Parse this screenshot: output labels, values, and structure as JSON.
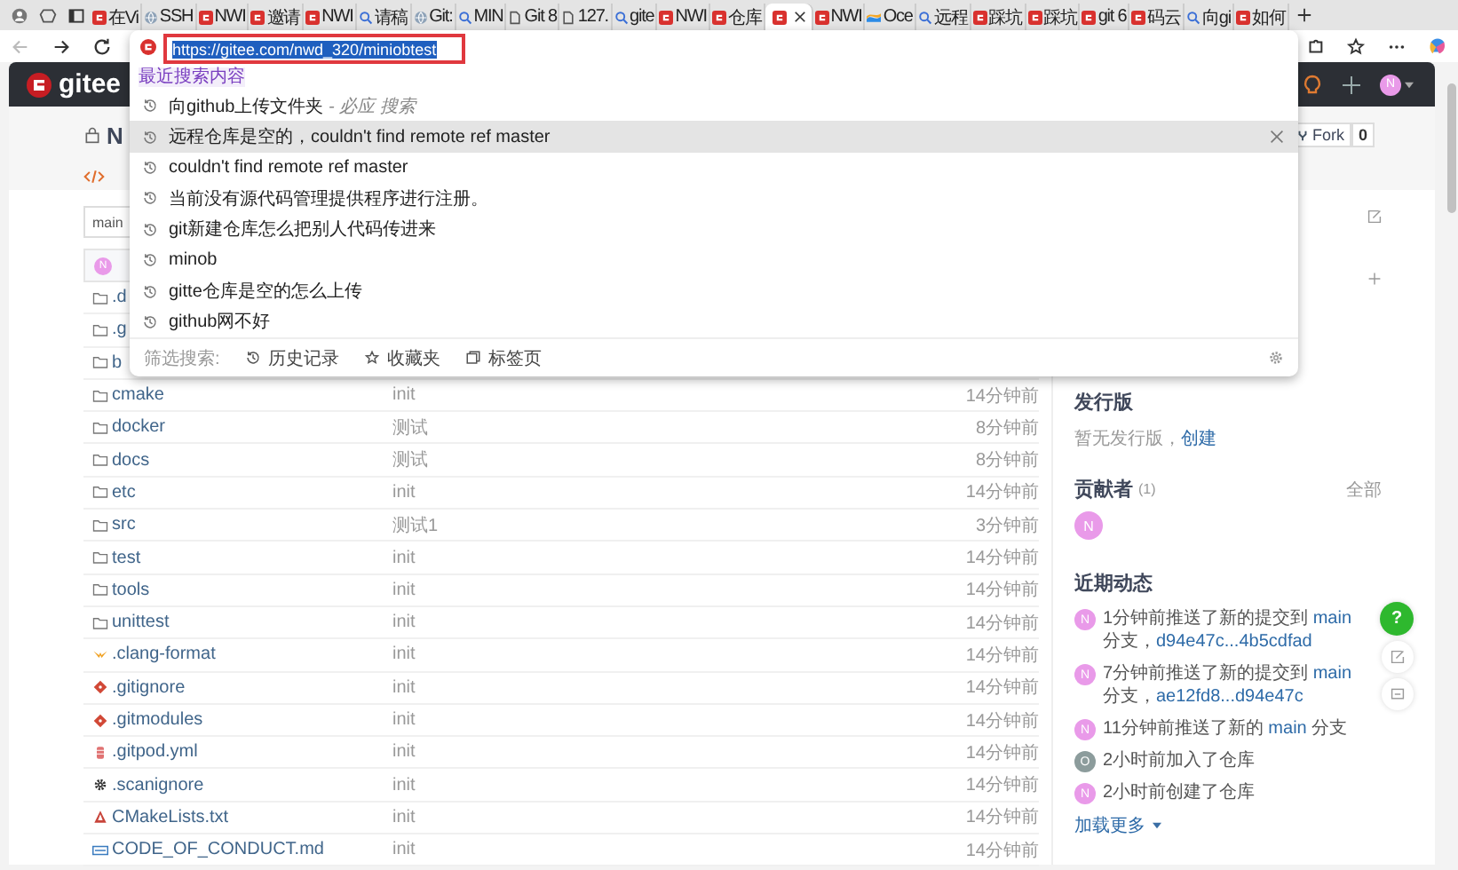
{
  "browser": {
    "tabs": [
      {
        "label": "在Vi",
        "kind": "gitee",
        "selected": false
      },
      {
        "label": "SSH",
        "kind": "globe",
        "selected": false
      },
      {
        "label": "NWI",
        "kind": "gitee",
        "selected": false
      },
      {
        "label": "邀请",
        "kind": "gitee",
        "selected": false
      },
      {
        "label": "NWI",
        "kind": "gitee",
        "selected": false
      },
      {
        "label": "请稿",
        "kind": "search",
        "selected": false
      },
      {
        "label": "Git:",
        "kind": "globe",
        "selected": false
      },
      {
        "label": "MIN",
        "kind": "search",
        "selected": false
      },
      {
        "label": "Git 8",
        "kind": "doc",
        "selected": false
      },
      {
        "label": "127.",
        "kind": "doc",
        "selected": false
      },
      {
        "label": "gite",
        "kind": "search",
        "selected": false
      },
      {
        "label": "NWI",
        "kind": "gitee",
        "selected": false
      },
      {
        "label": "仓库",
        "kind": "gitee",
        "selected": false
      },
      {
        "kind": "gitee",
        "selected": true
      },
      {
        "label": "NWI",
        "kind": "gitee",
        "selected": false
      },
      {
        "label": "Oce",
        "kind": "color",
        "selected": false
      },
      {
        "label": "远程",
        "kind": "search",
        "selected": false
      },
      {
        "label": "踩坑",
        "kind": "gitee",
        "selected": false
      },
      {
        "label": "踩坑",
        "kind": "gitee",
        "selected": false
      },
      {
        "label": "git 6",
        "kind": "gitee",
        "selected": false
      },
      {
        "label": "码云",
        "kind": "gitee",
        "selected": false
      },
      {
        "label": "向gi",
        "kind": "search",
        "selected": false
      },
      {
        "label": "如何",
        "kind": "gitee",
        "selected": false
      }
    ],
    "address": "https://gitee.com/nwd_320/miniobtest",
    "suggestions": {
      "heading": "最近搜索内容",
      "items": [
        {
          "text": "向github上传文件夹",
          "hint": "- 必应 搜索",
          "selected": false
        },
        {
          "text": "远程仓库是空的，couldn't find remote ref master",
          "selected": true
        },
        {
          "text": "couldn't find remote ref master",
          "selected": false
        },
        {
          "text": "当前没有源代码管理提供程序进行注册。",
          "selected": false
        },
        {
          "text": "git新建仓库怎么把别人代码传进来",
          "selected": false
        },
        {
          "text": "minob",
          "selected": false
        },
        {
          "text": "gitte仓库是空的怎么上传",
          "selected": false
        },
        {
          "text": "github网不好",
          "selected": false
        }
      ],
      "filter_label": "筛选搜索:",
      "filters": [
        {
          "label": "历史记录",
          "kind": "history"
        },
        {
          "label": "收藏夹",
          "kind": "star"
        },
        {
          "label": "标签页",
          "kind": "tabs"
        }
      ]
    }
  },
  "gitee": {
    "logo": "gitee",
    "avatar": "N"
  },
  "repo": {
    "title": "N",
    "fork_label": "Fork",
    "fork_count": "0",
    "branch": "main",
    "commit_avatar": "N"
  },
  "files": [
    {
      "name": ".d",
      "kind": "folder"
    },
    {
      "name": ".g",
      "kind": "folder"
    },
    {
      "name": "b",
      "kind": "folder"
    },
    {
      "name": "cmake",
      "kind": "folder",
      "message": "init",
      "time": "14分钟前"
    },
    {
      "name": "docker",
      "kind": "folder",
      "message": "测试",
      "time": "8分钟前"
    },
    {
      "name": "docs",
      "kind": "folder",
      "message": "测试",
      "time": "8分钟前"
    },
    {
      "name": "etc",
      "kind": "folder",
      "message": "init",
      "time": "14分钟前"
    },
    {
      "name": "src",
      "kind": "folder",
      "message": "测试1",
      "time": "3分钟前"
    },
    {
      "name": "test",
      "kind": "folder",
      "message": "init",
      "time": "14分钟前"
    },
    {
      "name": "tools",
      "kind": "folder",
      "message": "init",
      "time": "14分钟前"
    },
    {
      "name": "unittest",
      "kind": "folder",
      "message": "init",
      "time": "14分钟前"
    },
    {
      "name": ".clang-format",
      "kind": "clang",
      "message": "init",
      "time": "14分钟前"
    },
    {
      "name": ".gitignore",
      "kind": "git",
      "message": "init",
      "time": "14分钟前"
    },
    {
      "name": ".gitmodules",
      "kind": "git",
      "message": "init",
      "time": "14分钟前"
    },
    {
      "name": ".gitpod.yml",
      "kind": "gitpod",
      "message": "init",
      "time": "14分钟前"
    },
    {
      "name": ".scanignore",
      "kind": "gear",
      "message": "init",
      "time": "14分钟前"
    },
    {
      "name": "CMakeLists.txt",
      "kind": "cmake",
      "message": "init",
      "time": "14分钟前"
    },
    {
      "name": "CODE_OF_CONDUCT.md",
      "kind": "doc",
      "message": "init",
      "time": "14分钟前"
    }
  ],
  "sidebar": {
    "releases_title": "发行版",
    "releases_empty": "暂无发行版，",
    "releases_create": "创建",
    "contributors_title": "贡献者",
    "contributors_count": "(1)",
    "contributors_all": "全部",
    "contributors": [
      {
        "initial": "N",
        "color": "#e99ae9"
      }
    ],
    "activity_title": "近期动态",
    "activity": [
      {
        "initial": "N",
        "color": "#e99ae9",
        "segments": [
          {
            "text": "1分钟前推送了新的提交到 ",
            "link": false
          },
          {
            "text": "main",
            "link": true
          },
          {
            "text": " 分支，",
            "link": false
          },
          {
            "text": "d94e47c...4b5cdfad",
            "link": true
          }
        ]
      },
      {
        "initial": "N",
        "color": "#e99ae9",
        "segments": [
          {
            "text": "7分钟前推送了新的提交到 ",
            "link": false
          },
          {
            "text": "main",
            "link": true
          },
          {
            "text": " 分支，",
            "link": false
          },
          {
            "text": "ae12fd8...d94e47c",
            "link": true
          }
        ]
      },
      {
        "initial": "N",
        "color": "#e99ae9",
        "segments": [
          {
            "text": "11分钟前推送了新的 ",
            "link": false
          },
          {
            "text": "main",
            "link": true
          },
          {
            "text": " 分支",
            "link": false
          }
        ]
      },
      {
        "initial": "O",
        "color": "#8c9c9c",
        "segments": [
          {
            "text": "2小时前加入了仓库",
            "link": false
          }
        ]
      },
      {
        "initial": "N",
        "color": "#e99ae9",
        "segments": [
          {
            "text": "2小时前创建了仓库",
            "link": false
          }
        ]
      }
    ],
    "load_more": "加载更多"
  },
  "help": "?"
}
